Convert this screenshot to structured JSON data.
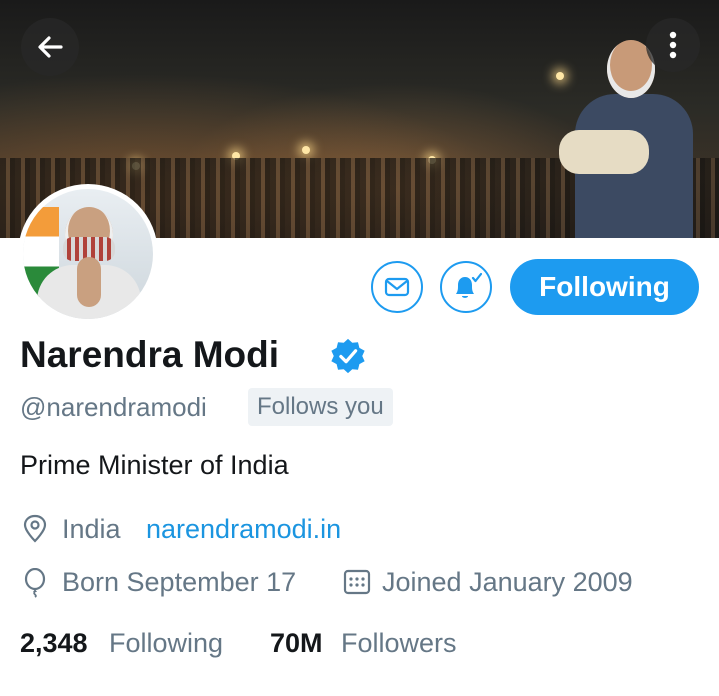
{
  "header": {
    "back_icon": "arrow-left-icon",
    "more_icon": "more-vertical-icon"
  },
  "profile": {
    "name": "Narendra Modi",
    "verified": true,
    "handle": "@narendramodi",
    "follows_you": "Follows you",
    "bio": "Prime Minister of India",
    "location": "India",
    "website": "narendramodi.in",
    "birthday": "Born September 17",
    "joined": "Joined January 2009",
    "following_count": "2,348",
    "following_label": "Following",
    "followers_count": "70M",
    "followers_label": "Followers"
  },
  "actions": {
    "message_icon": "envelope-icon",
    "notify_icon": "bell-check-icon",
    "follow_button": "Following"
  },
  "colors": {
    "accent": "#1d9bf0",
    "text_primary": "#14171a",
    "text_secondary": "#657786",
    "link": "#1b95e0"
  }
}
